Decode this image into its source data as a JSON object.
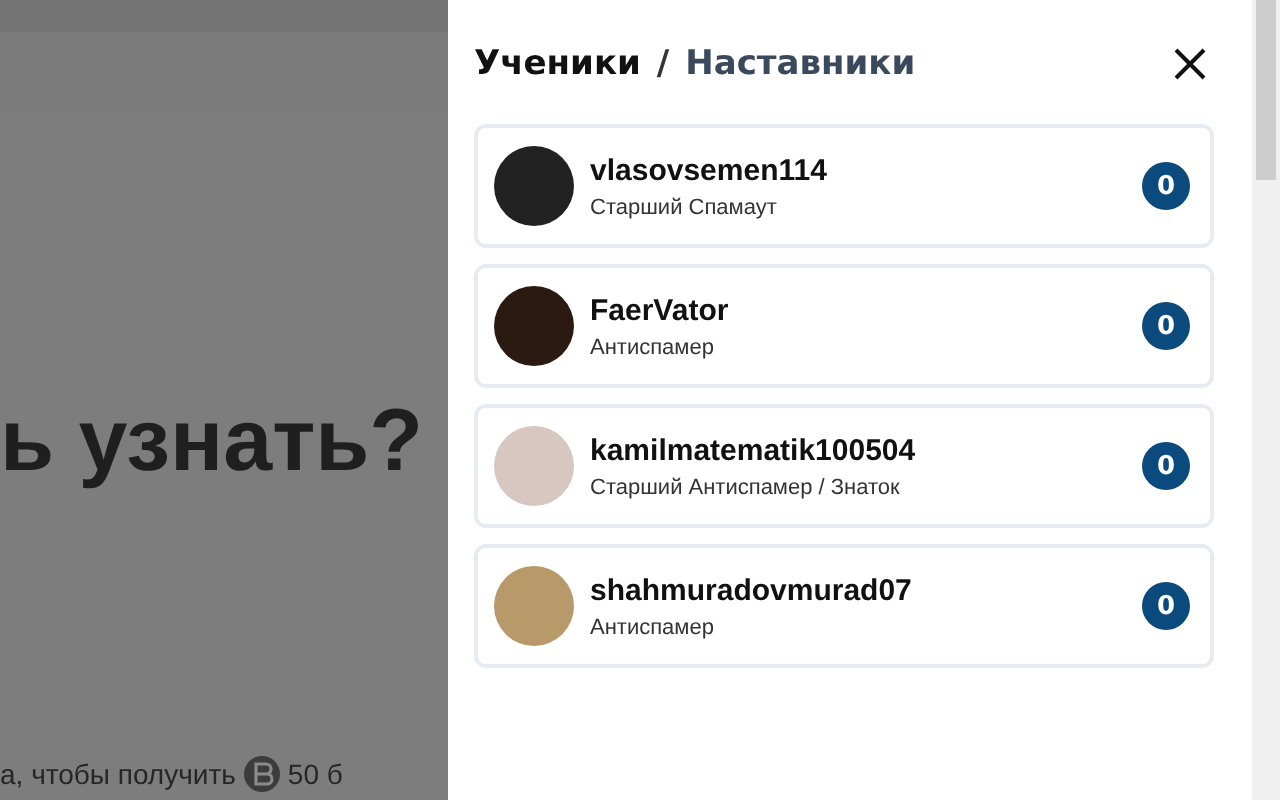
{
  "page": {
    "heading": "ь узнать?",
    "footer_text": "а, чтобы получить",
    "points": "50 б"
  },
  "panel": {
    "tabs": [
      {
        "label": "Ученики",
        "selected": true
      },
      {
        "label": "Наставники",
        "selected": false
      }
    ],
    "separator": "/",
    "users": [
      {
        "name": "vlasovsemen114",
        "role": "Старший Спамаут",
        "count": "0"
      },
      {
        "name": "FaerVator",
        "role": "Антиспамер",
        "count": "0"
      },
      {
        "name": "kamilmatematik100504",
        "role": "Старший Антиспамер / Знаток",
        "count": "0"
      },
      {
        "name": "shahmuradovmurad07",
        "role": "Антиспамер",
        "count": "0"
      }
    ]
  }
}
